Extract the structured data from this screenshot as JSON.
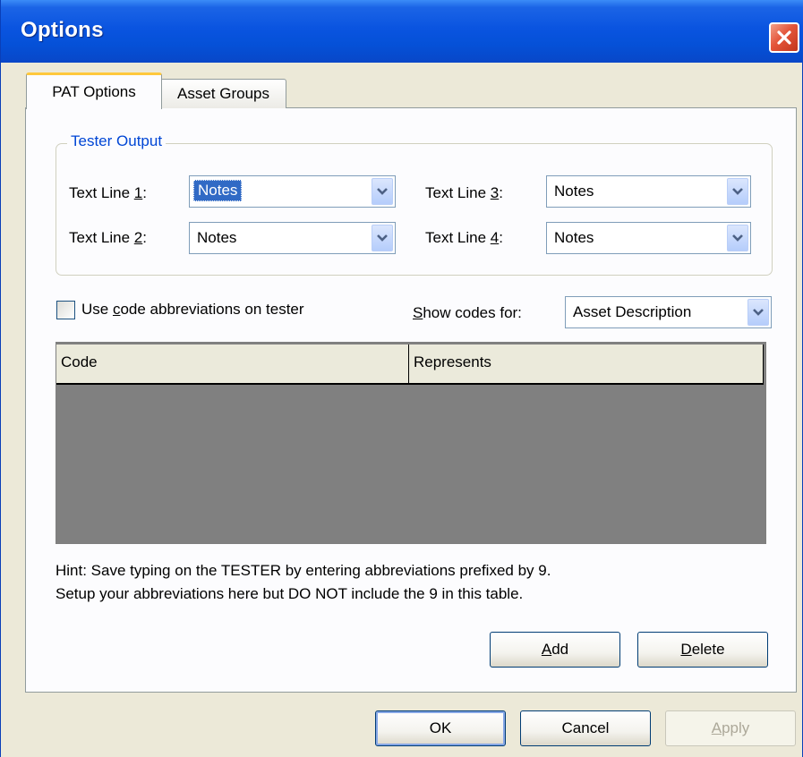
{
  "window": {
    "title": "Options"
  },
  "tabs": [
    {
      "label": "PAT Options"
    },
    {
      "label": "Asset Groups"
    }
  ],
  "tester_output": {
    "title": "Tester Output",
    "lines": [
      {
        "label": "Text Line 1:",
        "value": "Notes"
      },
      {
        "label": "Text Line 2:",
        "value": "Notes"
      },
      {
        "label": "Text Line 3:",
        "value": "Notes"
      },
      {
        "label": "Text Line 4:",
        "value": "Notes"
      }
    ]
  },
  "abbreviations": {
    "checkbox_label": "Use code abbreviations on tester",
    "checked": false,
    "show_codes_label": "Show codes for:",
    "show_codes_value": "Asset Description"
  },
  "table": {
    "columns": [
      "Code",
      "Represents"
    ],
    "rows": []
  },
  "hint": [
    "Hint: Save typing on the TESTER by entering abbreviations prefixed by 9.",
    "Setup your abbreviations here but DO NOT include the 9 in this table."
  ],
  "buttons": {
    "add": "Add",
    "delete": "Delete",
    "ok": "OK",
    "cancel": "Cancel",
    "apply": "Apply"
  }
}
